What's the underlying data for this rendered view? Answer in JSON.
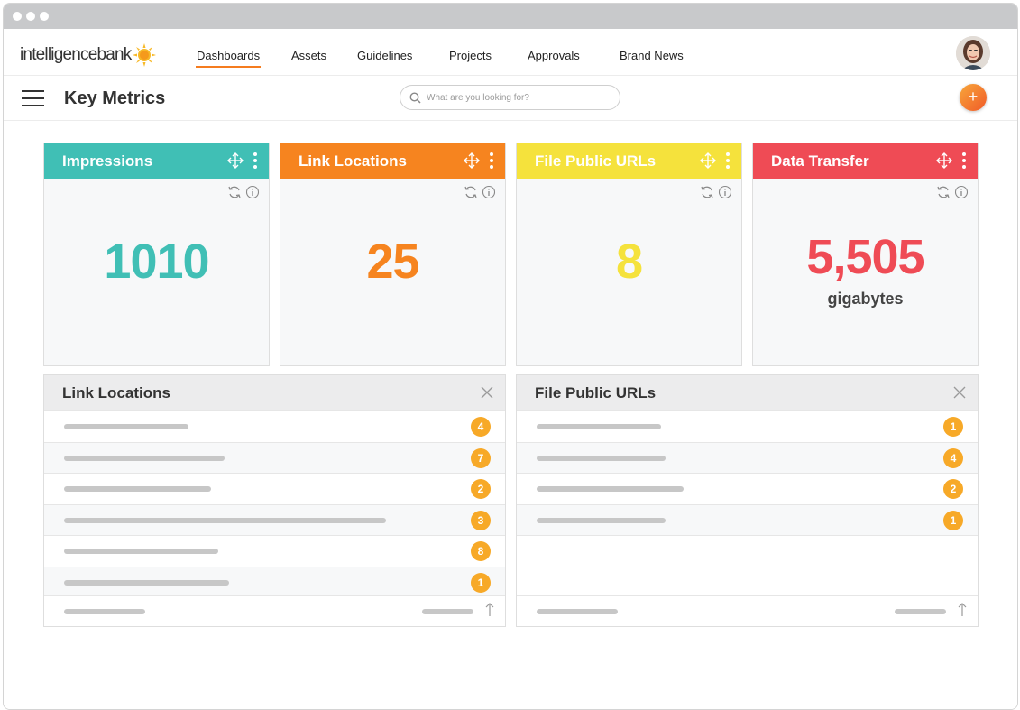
{
  "app": {
    "logo_text": "intelligencebank"
  },
  "nav": {
    "items": [
      {
        "label": "Dashboards",
        "active": true
      },
      {
        "label": "Assets"
      },
      {
        "label": "Guidelines"
      },
      {
        "label": "Projects"
      },
      {
        "label": "Approvals"
      },
      {
        "label": "Brand News"
      }
    ]
  },
  "header": {
    "title": "Key Metrics",
    "search_placeholder": "What are you looking for?",
    "add_label": "+"
  },
  "cards": [
    {
      "title": "Impressions",
      "value": "1010",
      "unit": "",
      "color": "#40bfb5"
    },
    {
      "title": "Link Locations",
      "value": "25",
      "unit": "",
      "color": "#f6841f"
    },
    {
      "title": "File Public URLs",
      "value": "8",
      "unit": "",
      "color": "#f5e23c"
    },
    {
      "title": "Data Transfer",
      "value": "5,505",
      "unit": "gigabytes",
      "color": "#ef4b55"
    }
  ],
  "panels": [
    {
      "title": "Link Locations",
      "counts": [
        "4",
        "7",
        "2",
        "3",
        "8",
        "1"
      ]
    },
    {
      "title": "File Public URLs",
      "counts": [
        "1",
        "4",
        "2",
        "1"
      ]
    }
  ],
  "icons": {
    "move": "move-arrows-icon",
    "menu": "kebab-menu-icon",
    "refresh": "refresh-icon",
    "info": "info-icon",
    "close": "close-icon",
    "sort": "sort-arrow-icon",
    "search": "search-icon"
  }
}
